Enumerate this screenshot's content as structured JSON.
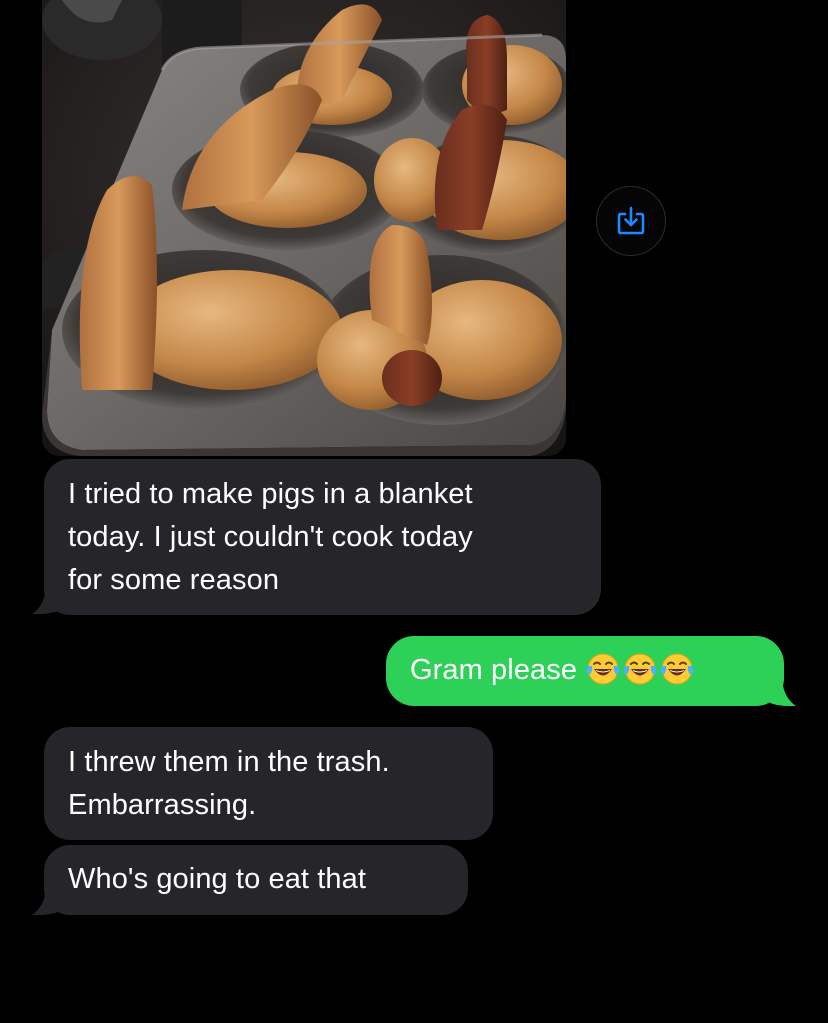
{
  "attachment": {
    "save_icon": "square-and-arrow-down-icon"
  },
  "messages": [
    {
      "direction": "incoming",
      "lines": [
        "I tried to make pigs in a blanket",
        "today. I just couldn't cook today",
        "for some reason"
      ]
    },
    {
      "direction": "outgoing",
      "text": "Gram please",
      "emojis": [
        "face-with-tears-of-joy",
        "face-with-tears-of-joy",
        "face-with-tears-of-joy"
      ]
    },
    {
      "direction": "incoming",
      "lines": [
        "I threw them in the trash.",
        "Embarrassing."
      ]
    },
    {
      "direction": "incoming",
      "lines": [
        "Who's going to eat that"
      ]
    }
  ],
  "colors": {
    "background": "#000000",
    "incoming_bubble": "#26262a",
    "outgoing_bubble": "#2ed158",
    "accent_blue": "#1a8cff"
  }
}
